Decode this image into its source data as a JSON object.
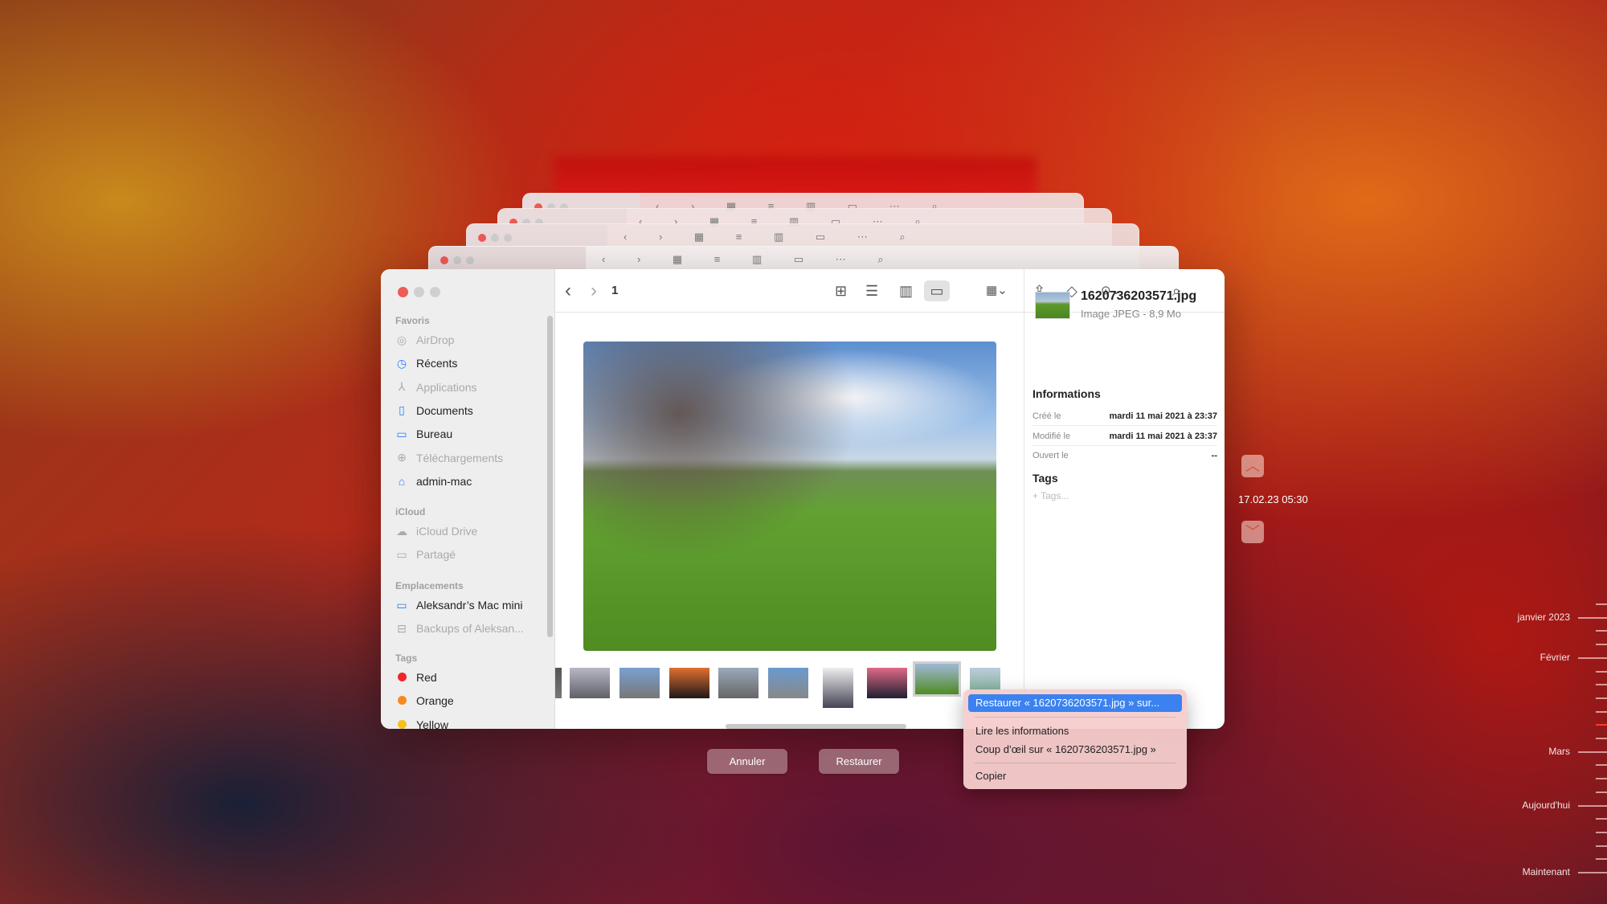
{
  "finder": {
    "path": "1",
    "sidebar": {
      "sections": [
        {
          "title": "Favoris",
          "items": [
            {
              "label": "AirDrop",
              "icon": "airdrop-icon",
              "dim": true
            },
            {
              "label": "Récents",
              "icon": "clock-icon",
              "dim": false
            },
            {
              "label": "Applications",
              "icon": "applications-icon",
              "dim": true
            },
            {
              "label": "Documents",
              "icon": "document-icon",
              "dim": false
            },
            {
              "label": "Bureau",
              "icon": "desktop-icon",
              "dim": false
            },
            {
              "label": "Téléchargements",
              "icon": "download-icon",
              "dim": true
            },
            {
              "label": "admin-mac",
              "icon": "home-icon",
              "dim": false
            }
          ]
        },
        {
          "title": "iCloud",
          "items": [
            {
              "label": "iCloud Drive",
              "icon": "cloud-icon",
              "dim": true
            },
            {
              "label": "Partagé",
              "icon": "shared-folder-icon",
              "dim": true
            }
          ]
        },
        {
          "title": "Emplacements",
          "items": [
            {
              "label": "Aleksandr’s Mac mini",
              "icon": "computer-icon",
              "dim": false
            },
            {
              "label": "Backups of Aleksan...",
              "icon": "drive-icon",
              "dim": true
            }
          ]
        },
        {
          "title": "Tags",
          "items": [
            {
              "label": "Red",
              "color": "#f0262a"
            },
            {
              "label": "Orange",
              "color": "#f68a1e"
            },
            {
              "label": "Yellow",
              "color": "#f5c21b"
            }
          ]
        }
      ]
    },
    "preview": {
      "filename": "1620736203571.jpg",
      "kind": "Image JPEG - 8,9 Mo",
      "info_title": "Informations",
      "rows": [
        {
          "label": "Créé le",
          "value": "mardi 11 mai 2021 à 23:37"
        },
        {
          "label": "Modifié le",
          "value": "mardi 11 mai 2021 à 23:37"
        },
        {
          "label": "Ouvert le",
          "value": "--"
        }
      ],
      "tags_title": "Tags",
      "tags_placeholder": "+ Tags..."
    }
  },
  "context_menu": {
    "items": [
      "Restaurer « 1620736203571.jpg » sur...",
      "Lire les informations",
      "Coup d’œil sur « 1620736203571.jpg »",
      "Copier"
    ],
    "highlight_color": "#3b82f0"
  },
  "buttons": {
    "cancel": "Annuler",
    "restore": "Restaurer"
  },
  "time_machine": {
    "current_snapshot": "17.02.23 05:30",
    "timeline": [
      "janvier 2023",
      "Février",
      "Mars",
      "Aujourd'hui",
      "Maintenant"
    ]
  }
}
